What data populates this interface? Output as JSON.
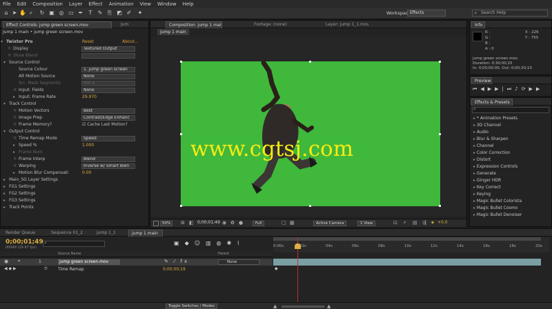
{
  "menu": [
    "File",
    "Edit",
    "Composition",
    "Layer",
    "Effect",
    "Animation",
    "View",
    "Window",
    "Help"
  ],
  "toolbar": {
    "workspace_label": "Workspace:",
    "workspace_value": "Effects",
    "search_placeholder": "Search Help"
  },
  "effect_controls": {
    "tab_label": "Effect Controls: jump green screen.mov",
    "tab2_label": "Jum",
    "title": "Jump 1 main • jump green screen.mov",
    "rows": [
      {
        "indent": 8,
        "label": "Twixtor Pro",
        "right": "Reset",
        "right2": "About...",
        "bold": true,
        "expander": "▾"
      },
      {
        "indent": 18,
        "label": "Display",
        "value": "Textured Output",
        "expander": "☼"
      },
      {
        "indent": 18,
        "label": "Show Blend",
        "dim": true,
        "value": "",
        "expander": "☼"
      },
      {
        "indent": 12,
        "label": "Source Control",
        "expander": "▾"
      },
      {
        "indent": 26,
        "label": "Source Colour",
        "value": "1. jump green screen"
      },
      {
        "indent": 26,
        "label": "Alt Motion Source",
        "value": "None"
      },
      {
        "indent": 26,
        "label": "Src. Mask Segments",
        "dim": true,
        "value": "Not a"
      },
      {
        "indent": 26,
        "label": "Input: Fields",
        "value": "None",
        "expander": "☼"
      },
      {
        "indent": 26,
        "label": "Input: Frame Rate",
        "num": "29.970",
        "expander": "▸"
      },
      {
        "indent": 12,
        "label": "Track Control",
        "expander": "▾"
      },
      {
        "indent": 26,
        "label": "Motion Vectors",
        "value": "Best",
        "expander": "☼"
      },
      {
        "indent": 26,
        "label": "Image Prep",
        "value": "Contrast/Edge Enhanc",
        "expander": "☼"
      },
      {
        "indent": 26,
        "label": "Frame Memory?",
        "check": "Cache Last Motion?",
        "expander": "☼"
      },
      {
        "indent": 12,
        "label": "Output Control",
        "expander": "▾"
      },
      {
        "indent": 26,
        "label": "Time Remap Mode",
        "value": "Speed",
        "expander": "☼"
      },
      {
        "indent": 26,
        "label": "Speed %",
        "num": "1.000",
        "expander": "▸"
      },
      {
        "indent": 26,
        "label": "Frame Num",
        "dim": true,
        "num": "",
        "expander": "▸"
      },
      {
        "indent": 26,
        "label": "Frame Interp",
        "value": "Blend",
        "expander": "☼"
      },
      {
        "indent": 26,
        "label": "Warping",
        "value": "Inverse w/ Smart Blen",
        "expander": "☼"
      },
      {
        "indent": 26,
        "label": "Motion Blur Compensati",
        "num": "0.00",
        "expander": "▸"
      },
      {
        "indent": 12,
        "label": "Main_SG Layer Settings",
        "expander": "▸"
      },
      {
        "indent": 12,
        "label": "FG1 Settings",
        "expander": "▸"
      },
      {
        "indent": 12,
        "label": "FG2 Settings",
        "expander": "▸"
      },
      {
        "indent": 12,
        "label": "FG3 Settings",
        "expander": "▸"
      },
      {
        "indent": 12,
        "label": "Track Points",
        "expander": "▸"
      }
    ]
  },
  "composition": {
    "tab_label": "Composition: jump 1 main",
    "footage_tab": "Footage: (none)",
    "layer_tab": "Layer: jump 1_1.mov",
    "breadcrumb": "jump 1 main",
    "zoom": "50%",
    "timecode": "0;00;01;49",
    "resolution": "Full",
    "camera": "Active Camera",
    "views": "1 View",
    "exposure": "+0.0",
    "watermark": "www.cgtsj.com"
  },
  "info": {
    "tab": "Info",
    "r": "R :",
    "g": "G :",
    "b": "B :",
    "a": "A : 0",
    "x": "X : 226",
    "y": "Y : 755",
    "file": "jump green screen.mov",
    "duration": "Duration: 0;30;00;15",
    "inout": "In: 0;00;00;00, Out: 0;00;20;10"
  },
  "preview": {
    "tab": "Preview"
  },
  "effects_presets": {
    "tab": "Effects & Presets",
    "items": [
      "* Animation Presets",
      "3D Channel",
      "Audio",
      "Blur & Sharpen",
      "Channel",
      "Color Correction",
      "Distort",
      "Expression Controls",
      "Generate",
      "Ginger HDR",
      "Key Correct",
      "Keying",
      "Magic Bullet Colorista",
      "Magic Bullet Cosmo",
      "Magic Bullet Denoiser"
    ]
  },
  "timeline": {
    "tabs": [
      "Render Queue",
      "Sequence 01_2",
      "jump 1_1",
      "jump 1 main"
    ],
    "timecode": "0;00;01;49",
    "timecode_sub": "00049 (29.97 fps)",
    "search_placeholder": "",
    "col_source": "Source Name",
    "col_parent": "Parent",
    "layer_num": "1",
    "layer_name": "jump green screen.mov",
    "layer_parent": "None",
    "sub_prop": "Time Remap",
    "sub_value": "0;00;00;19",
    "ruler": [
      "0:00s",
      "02s",
      "04s",
      "06s",
      "08s",
      "10s",
      "12s",
      "14s",
      "16s",
      "18s",
      "20s"
    ],
    "bottom_toggle": "Toggle Switches / Modes"
  },
  "colors": {
    "accent": "#e0b040",
    "green_screen": "#3fb83b",
    "watermark": "#f7ec12"
  }
}
